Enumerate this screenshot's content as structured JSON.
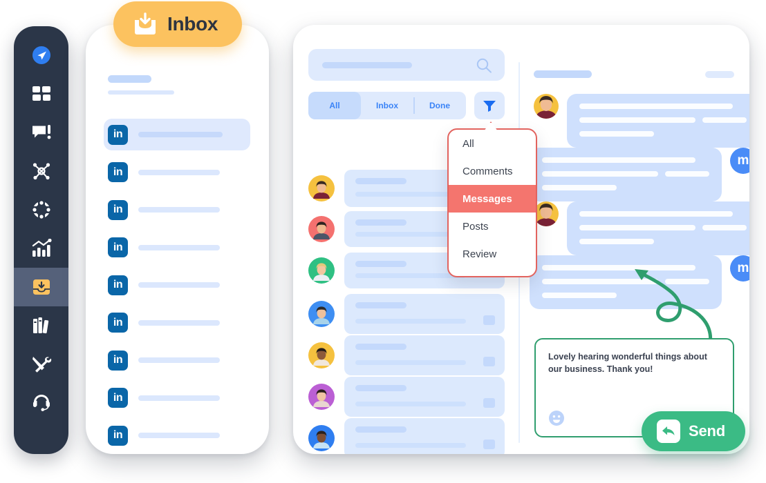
{
  "colors": {
    "sidebar_bg": "#2b3648",
    "sidebar_active": "#55617a",
    "accent_blue": "#3a83f7",
    "accent_yellow": "#fcc25f",
    "dropdown_border": "#e2635e",
    "dropdown_selected": "#f4756e",
    "send_green": "#3bbb85",
    "reply_border": "#2f9e6e",
    "linkedin_blue": "#0a66a8",
    "bubble_blue": "#cfe0fd",
    "placeholder_blue": "#dfeafd"
  },
  "sidebar": {
    "items": [
      {
        "name": "send-icon",
        "label": "Send",
        "active": false,
        "highlight": "blue"
      },
      {
        "name": "dashboard-icon",
        "label": "Dashboard",
        "active": false
      },
      {
        "name": "comment-alert-icon",
        "label": "Engage",
        "active": false
      },
      {
        "name": "network-icon",
        "label": "Network",
        "active": false
      },
      {
        "name": "target-icon",
        "label": "Targeting",
        "active": false
      },
      {
        "name": "analytics-chart-icon",
        "label": "Analytics",
        "active": false
      },
      {
        "name": "inbox-icon",
        "label": "Inbox",
        "active": true
      },
      {
        "name": "library-icon",
        "label": "Library",
        "active": false
      },
      {
        "name": "tools-icon",
        "label": "Tools",
        "active": false
      },
      {
        "name": "headset-support-icon",
        "label": "Support",
        "active": false
      }
    ]
  },
  "inbox_badge": {
    "label": "Inbox",
    "icon": "inbox-download-icon"
  },
  "phone": {
    "list_title_placeholder": "",
    "items": [
      {
        "network": "in",
        "selected": true
      },
      {
        "network": "in",
        "selected": false
      },
      {
        "network": "in",
        "selected": false
      },
      {
        "network": "in",
        "selected": false
      },
      {
        "network": "in",
        "selected": false
      },
      {
        "network": "in",
        "selected": false
      },
      {
        "network": "in",
        "selected": false
      },
      {
        "network": "in",
        "selected": false
      },
      {
        "network": "in",
        "selected": false
      }
    ]
  },
  "main": {
    "search": {
      "placeholder": "",
      "icon": "search-icon"
    },
    "tabs": [
      {
        "label": "All",
        "active": true
      },
      {
        "label": "Inbox",
        "active": false
      },
      {
        "label": "Done",
        "active": false
      }
    ],
    "filter_button": {
      "icon": "filter-funnel-icon",
      "label": ""
    },
    "dropdown": {
      "open": true,
      "items": [
        {
          "label": "All",
          "selected": false
        },
        {
          "label": "Comments",
          "selected": false
        },
        {
          "label": "Messages",
          "selected": true
        },
        {
          "label": "Posts",
          "selected": false
        },
        {
          "label": "Review",
          "selected": false
        }
      ]
    },
    "conversations": [
      {
        "avatar_color": "#f5c13f",
        "hair": "#3a2a22",
        "skin": "#f0bb93",
        "shirt": "#7a2236",
        "has_chat_icon": false
      },
      {
        "avatar_color": "#f4716f",
        "hair": "#2e2420",
        "skin": "#eeb98f",
        "shirt": "#4b5668",
        "has_chat_icon": false
      },
      {
        "avatar_color": "#2fc083",
        "hair": "#e3c87c",
        "skin": "#f3c6a0",
        "shirt": "#eceff4",
        "has_chat_icon": false
      },
      {
        "avatar_color": "#3e8ef2",
        "hair": "#2b2a2b",
        "skin": "#eec09b",
        "shirt": "#a8d3ea",
        "has_chat_icon": true
      },
      {
        "avatar_color": "#f5c13f",
        "hair": "#241d1a",
        "skin": "#8d5a3a",
        "shirt": "#f1e7dc",
        "has_chat_icon": true
      },
      {
        "avatar_color": "#bb5fd4",
        "hair": "#2c1f1d",
        "skin": "#f0c3a2",
        "shirt": "#e9d6d0",
        "has_chat_icon": true
      },
      {
        "avatar_color": "#2f7ef0",
        "hair": "#2a211f",
        "skin": "#7d4e33",
        "shirt": "#c8e3f5",
        "has_chat_icon": true
      }
    ]
  },
  "chat": {
    "header_name_placeholder": "",
    "header_meta_placeholder": "",
    "messages": [
      {
        "side": "left",
        "sender": "contact",
        "avatar_color": "#f5c13f",
        "lines": 3
      },
      {
        "side": "right",
        "sender": "me",
        "badge": "m",
        "lines": 3
      },
      {
        "side": "left",
        "sender": "contact",
        "avatar_color": "#f5c13f",
        "lines": 3
      },
      {
        "side": "right",
        "sender": "me",
        "badge": "m",
        "lines": 3
      }
    ],
    "reply": {
      "text": "Lovely hearing wonderful things about our business. Thank you!",
      "emoji_icon": "smiley-face-icon"
    },
    "send_button": {
      "label": "Send",
      "icon": "reply-arrow-icon"
    },
    "annotation": {
      "icon": "curved-green-arrow"
    }
  }
}
